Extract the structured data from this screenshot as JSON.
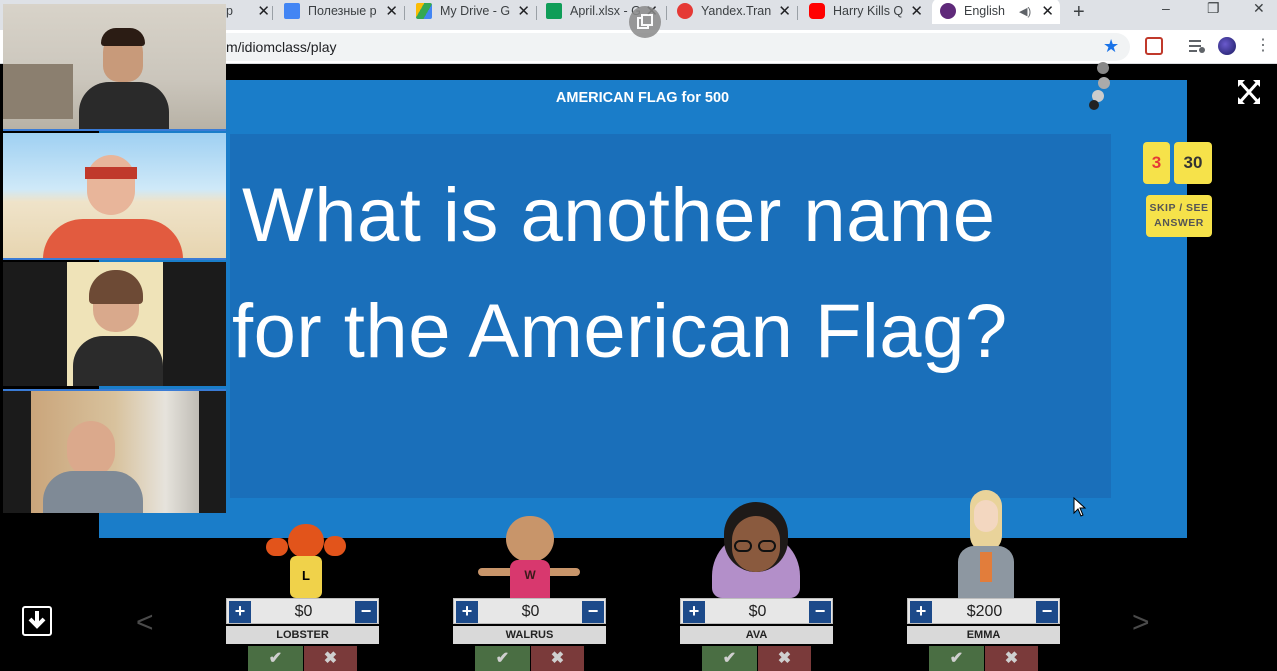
{
  "browser": {
    "tabs": [
      {
        "title": "р",
        "favicon_color": "#1a73e8"
      },
      {
        "title": "Полезные р",
        "favicon_color": "#4285f4"
      },
      {
        "title": "My Drive - G",
        "favicon_color": "#34a853"
      },
      {
        "title": "April.xlsx - G",
        "favicon_color": "#0f9d58"
      },
      {
        "title": "Yandex.Trans",
        "favicon_color": "#e53935"
      },
      {
        "title": "Harry Kills Q",
        "favicon_color": "#ff0000"
      },
      {
        "title": "English",
        "favicon_color": "#5f2a7a"
      }
    ],
    "url": "m/idiomclass/play",
    "window_controls": [
      "–",
      "❐",
      "✕"
    ]
  },
  "game": {
    "category_title": "AMERICAN FLAG for 500",
    "question_line1": "What is another name",
    "question_line2": "for the American Flag?",
    "counter_left": "3",
    "counter_right": "30",
    "skip_line1": "SKIP / SEE",
    "skip_line2": "ANSWER",
    "nav_prev": "<",
    "nav_next": ">"
  },
  "players": [
    {
      "name": "LOBSTER",
      "score": "$0",
      "avatar_letter": "L"
    },
    {
      "name": "WALRUS",
      "score": "$0",
      "avatar_letter": "W"
    },
    {
      "name": "AVA",
      "score": "$0"
    },
    {
      "name": "EMMA",
      "score": "$200"
    }
  ],
  "colors": {
    "board": "#1a7dc9",
    "counter": "#f6e24a",
    "counter_highlight": "#e53935",
    "plus_minus": "#1c4a8a"
  }
}
